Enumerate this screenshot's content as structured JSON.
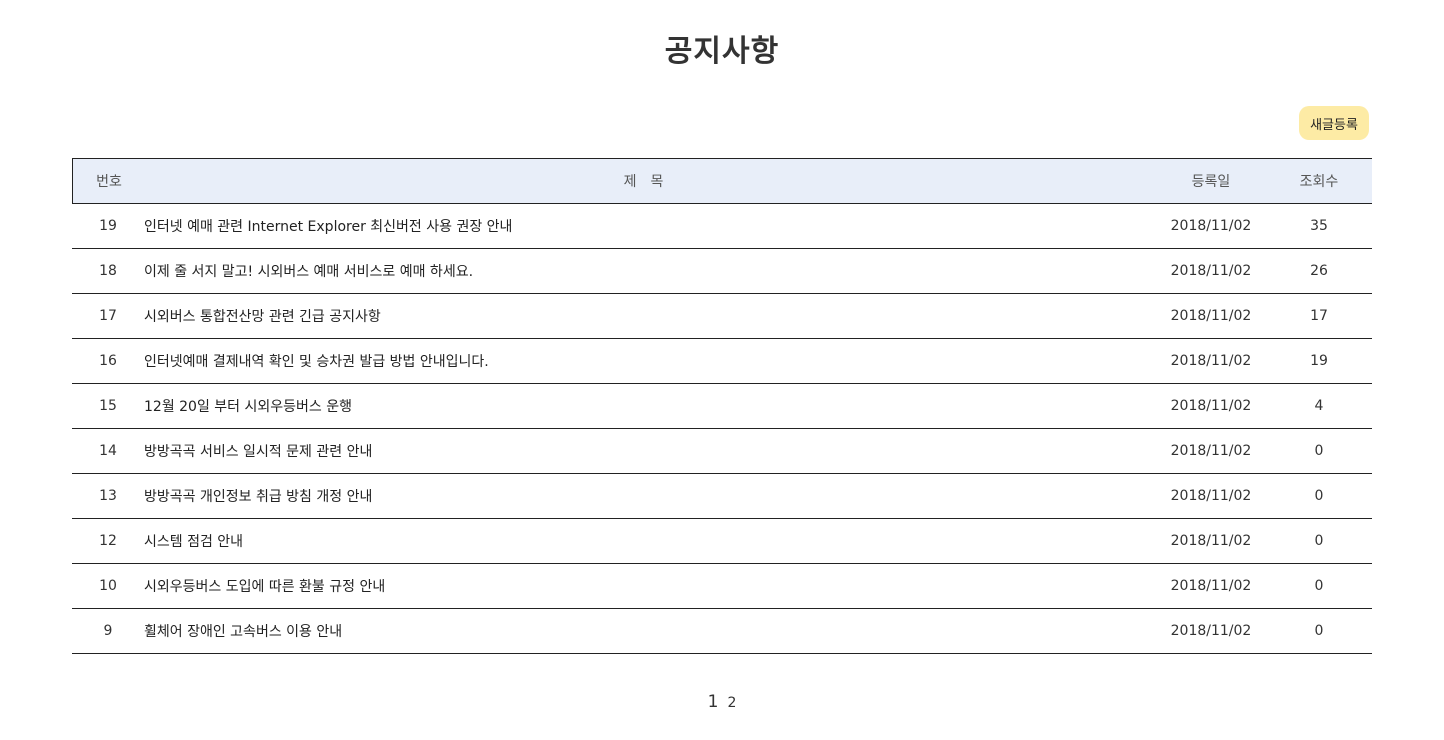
{
  "page": {
    "title": "공지사항"
  },
  "toolbar": {
    "new_post_label": "새글등록"
  },
  "table": {
    "headers": {
      "number": "번호",
      "title": "제목",
      "date": "등록일",
      "views": "조회수"
    },
    "rows": [
      {
        "number": "19",
        "title": "인터넷 예매 관련 Internet Explorer 최신버전 사용 권장 안내",
        "date": "2018/11/02",
        "views": "35"
      },
      {
        "number": "18",
        "title": "이제 줄 서지 말고! 시외버스 예매 서비스로 예매 하세요.",
        "date": "2018/11/02",
        "views": "26"
      },
      {
        "number": "17",
        "title": "시외버스 통합전산망 관련 긴급 공지사항",
        "date": "2018/11/02",
        "views": "17"
      },
      {
        "number": "16",
        "title": "인터넷예매 결제내역 확인 및 승차권 발급 방법 안내입니다.",
        "date": "2018/11/02",
        "views": "19"
      },
      {
        "number": "15",
        "title": "12월 20일 부터 시외우등버스 운행",
        "date": "2018/11/02",
        "views": "4"
      },
      {
        "number": "14",
        "title": "방방곡곡 서비스 일시적 문제 관련 안내",
        "date": "2018/11/02",
        "views": "0"
      },
      {
        "number": "13",
        "title": "방방곡곡 개인정보 취급 방침 개정 안내",
        "date": "2018/11/02",
        "views": "0"
      },
      {
        "number": "12",
        "title": "시스템 점검 안내",
        "date": "2018/11/02",
        "views": "0"
      },
      {
        "number": "10",
        "title": "시외우등버스 도입에 따른 환불 규정 안내",
        "date": "2018/11/02",
        "views": "0"
      },
      {
        "number": "9",
        "title": "휠체어 장애인 고속버스 이용 안내",
        "date": "2018/11/02",
        "views": "0"
      }
    ]
  },
  "pagination": {
    "pages": [
      "1",
      "2"
    ],
    "current": "1"
  },
  "colors": {
    "header_bg": "#e8eef9",
    "button_bg": "#fdeba5",
    "text": "#333333"
  }
}
